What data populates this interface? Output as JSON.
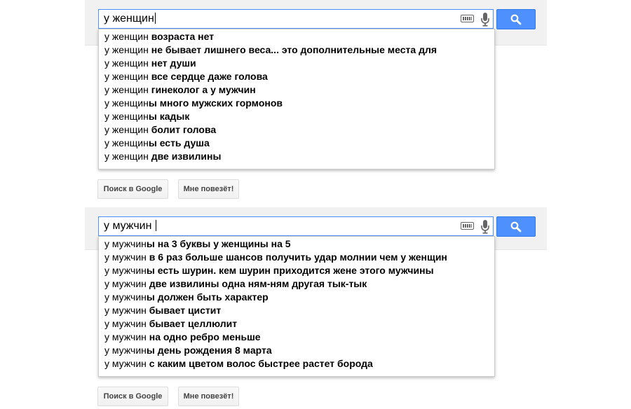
{
  "colors": {
    "accent_blue": "#4d90fe",
    "panel_gray": "#f1f1f1"
  },
  "icons": [
    "keyboard-icon",
    "microphone-icon",
    "magnifier-icon"
  ],
  "blocks": [
    {
      "query": "у женщин",
      "suggestions": [
        {
          "prefix": "у женщин",
          "completion": " возраста нет"
        },
        {
          "prefix": "у женщин",
          "completion": " не бывает лишнего веса... это дополнительные места для"
        },
        {
          "prefix": "у женщин",
          "completion": " нет души"
        },
        {
          "prefix": "у женщин",
          "completion": " все сердце даже голова"
        },
        {
          "prefix": "у женщин",
          "completion": " гинеколог а у мужчин"
        },
        {
          "prefix": "у женщин",
          "completion": "ы много мужских гормонов"
        },
        {
          "prefix": "у женщин",
          "completion": "ы кадык"
        },
        {
          "prefix": "у женщин",
          "completion": " болит голова"
        },
        {
          "prefix": "у женщин",
          "completion": "ы есть душа"
        },
        {
          "prefix": "у женщин",
          "completion": " две извилины"
        }
      ],
      "buttons": {
        "search_label": "Поиск в Google",
        "lucky_label": "Мне повезёт!"
      }
    },
    {
      "query": "у мужчин ",
      "suggestions": [
        {
          "prefix": "у мужчин",
          "completion": "ы на 3 буквы у женщины на 5"
        },
        {
          "prefix": "у мужчин",
          "completion": " в 6 раз больше шансов получить удар молнии чем у женщин"
        },
        {
          "prefix": "у мужчин",
          "completion": "ы есть шурин. кем шурин приходится жене этого мужчины"
        },
        {
          "prefix": "у мужчин",
          "completion": " две извилины одна ням-ням другая тык-тык"
        },
        {
          "prefix": "у мужчин",
          "completion": "ы должен быть характер"
        },
        {
          "prefix": "у мужчин",
          "completion": " бывает цистит"
        },
        {
          "prefix": "у мужчин",
          "completion": " бывает целлюлит"
        },
        {
          "prefix": "у мужчин",
          "completion": " на одно ребро меньше"
        },
        {
          "prefix": "у мужчин",
          "completion": "ы день рождения 8 марта"
        },
        {
          "prefix": "у мужчин",
          "completion": " с каким цветом волос быстрее растет борода"
        }
      ],
      "buttons": {
        "search_label": "Поиск в Google",
        "lucky_label": "Мне повезёт!"
      }
    }
  ]
}
